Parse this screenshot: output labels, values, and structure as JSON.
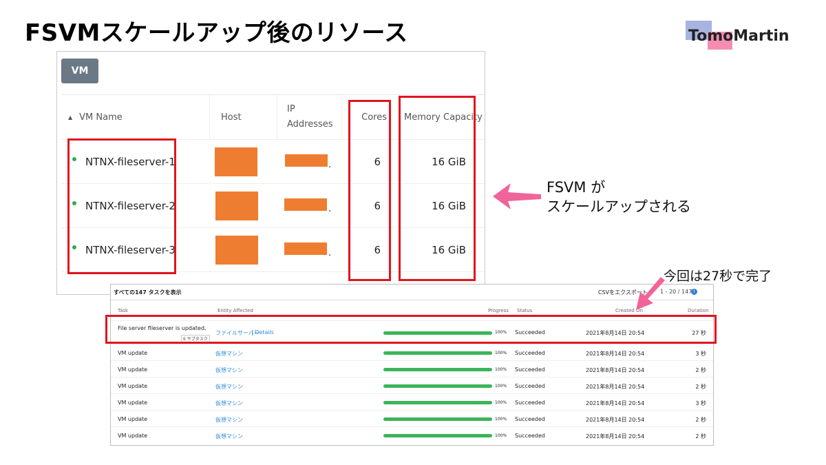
{
  "slide": {
    "title": "FSVMスケールアップ後のリソース",
    "logo_text": "TomoMartin",
    "note_scale": [
      "FSVM が",
      "スケールアップされる"
    ],
    "note_time": "今回は27秒で完了"
  },
  "vm_panel": {
    "tab_label": "VM",
    "columns": {
      "sort_indicator": "▲",
      "vm_name": "VM Name",
      "host": "Host",
      "ip_line1": "IP",
      "ip_line2": "Addresses",
      "cores": "Cores",
      "memory": "Memory Capacity"
    },
    "rows": [
      {
        "name": "NTNX-fileserver-1",
        "ip_suffix": ".",
        "cores": "6",
        "memory": "16 GiB"
      },
      {
        "name": "NTNX-fileserver-2",
        "ip_suffix": ".",
        "cores": "6",
        "memory": "16 GiB"
      },
      {
        "name": "NTNX-fileserver-3",
        "ip_suffix": ".",
        "cores": "6",
        "memory": "16 GiB"
      }
    ]
  },
  "task_panel": {
    "title": "すべての147 タスクを表示",
    "export_label": "CSVをエクスポート",
    "pagination": "1 - 20 / 147",
    "info_icon": "i",
    "columns": {
      "task": "Task",
      "entity": "Entity Affected",
      "progress": "Progress",
      "status": "Status",
      "created": "Created On",
      "duration": "Duration"
    },
    "rows": [
      {
        "task": "File server fileserver is updated.",
        "subtask": "6 サブタスク",
        "entity": "ファイルサーバー",
        "details": " | Details",
        "progress": 1.0,
        "progress_label": "100%",
        "status": "Succeeded",
        "created": "2021年8月14日 20:54",
        "duration": "27 秒"
      },
      {
        "task": "VM update",
        "entity": "仮想マシン",
        "progress": 1.0,
        "progress_label": "100%",
        "status": "Succeeded",
        "created": "2021年8月14日 20:54",
        "duration": "3 秒"
      },
      {
        "task": "VM update",
        "entity": "仮想マシン",
        "progress": 1.0,
        "progress_label": "100%",
        "status": "Succeeded",
        "created": "2021年8月14日 20:54",
        "duration": "2 秒"
      },
      {
        "task": "VM update",
        "entity": "仮想マシン",
        "progress": 1.0,
        "progress_label": "100%",
        "status": "Succeeded",
        "created": "2021年8月14日 20:54",
        "duration": "2 秒"
      },
      {
        "task": "VM update",
        "entity": "仮想マシン",
        "progress": 1.0,
        "progress_label": "100%",
        "status": "Succeeded",
        "created": "2021年8月14日 20:54",
        "duration": "3 秒"
      },
      {
        "task": "VM update",
        "entity": "仮想マシン",
        "progress": 1.0,
        "progress_label": "100%",
        "status": "Succeeded",
        "created": "2021年8月14日 20:54",
        "duration": "2 秒"
      },
      {
        "task": "VM update",
        "entity": "仮想マシン",
        "progress": 1.0,
        "progress_label": "100%",
        "status": "Succeeded",
        "created": "2021年8月14日 20:54",
        "duration": "2 秒"
      }
    ]
  },
  "colors": {
    "highlight_red": "#e0141e",
    "mask_orange": "#ee7d31",
    "arrow_pink": "#f0649a",
    "success_green": "#3cb45a",
    "link_blue": "#2f8bd6"
  }
}
